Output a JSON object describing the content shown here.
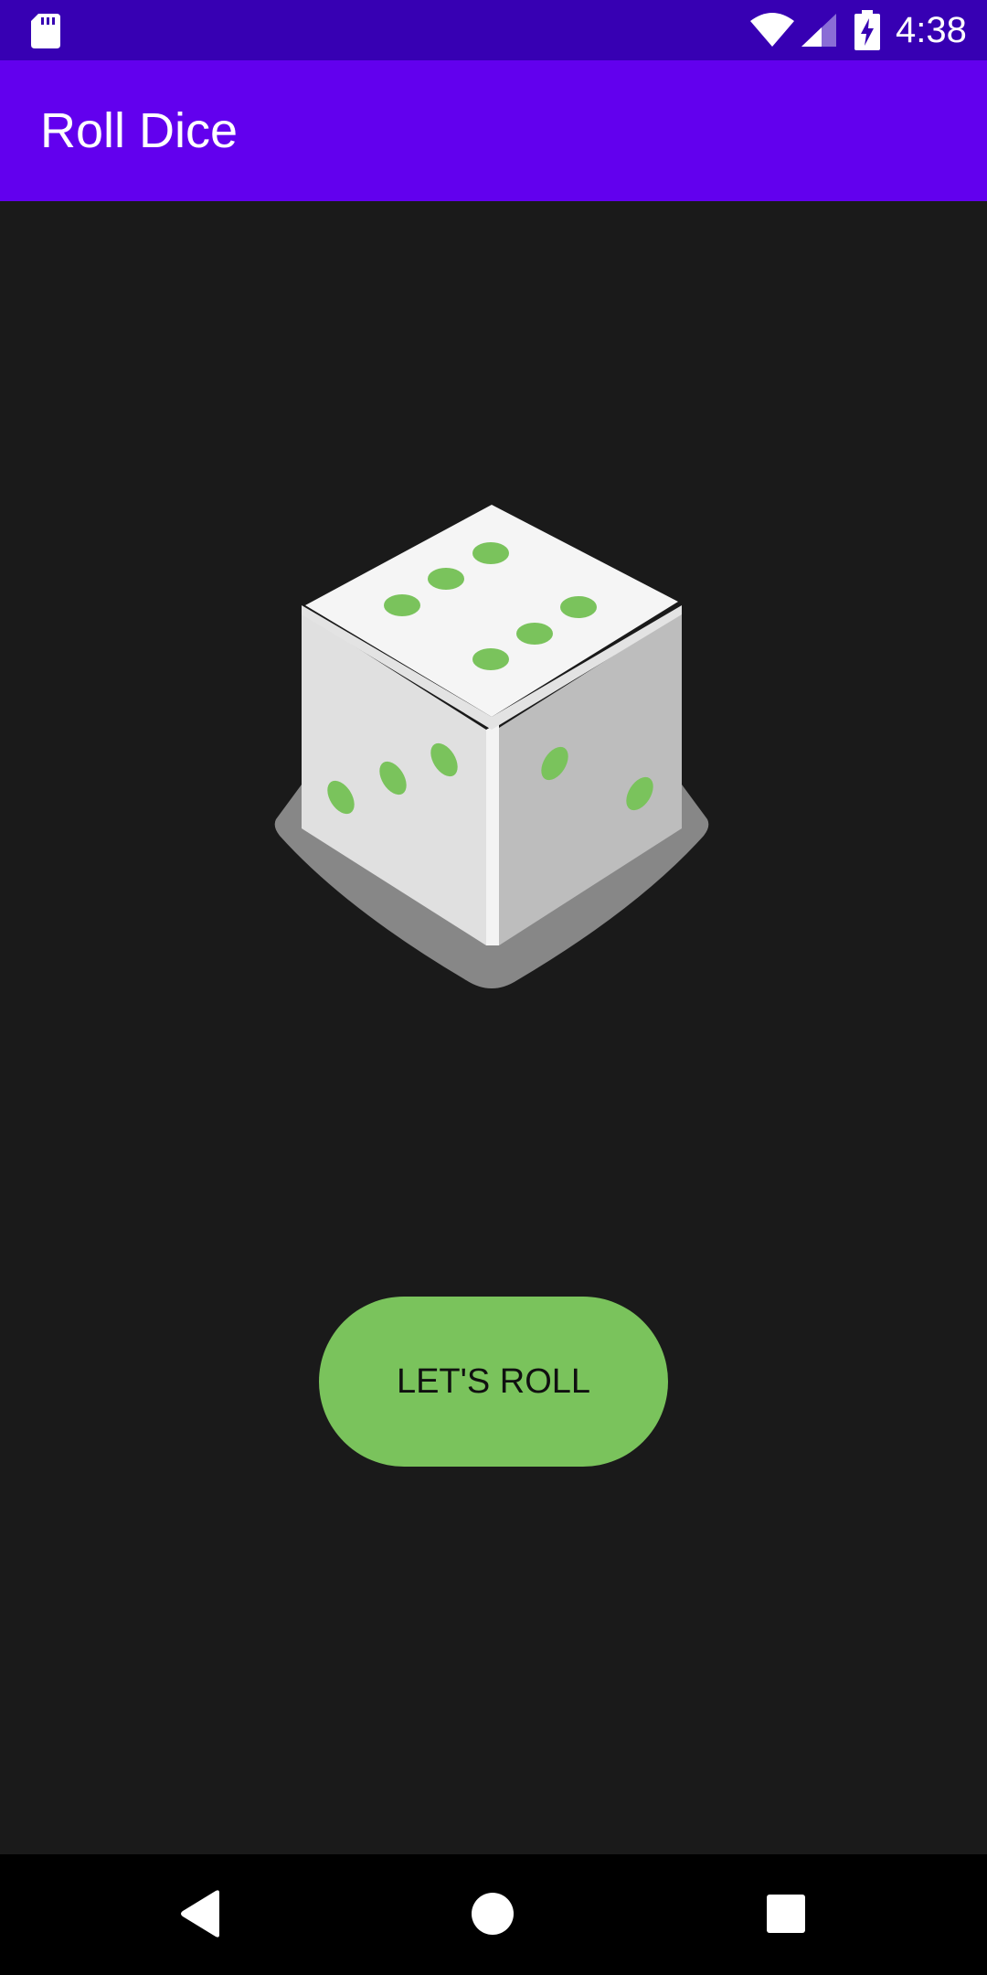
{
  "status_bar": {
    "time": "4:38",
    "icons": [
      "sd-card-icon",
      "wifi-icon",
      "cell-signal-icon",
      "battery-charging-icon"
    ]
  },
  "app_bar": {
    "title": "Roll Dice"
  },
  "dice": {
    "icon": "dice-icon",
    "pip_color": "#7ac35c"
  },
  "roll_button": {
    "label": "LET'S ROLL"
  },
  "nav_bar": {
    "icons": [
      "back-icon",
      "home-icon",
      "recents-icon"
    ]
  },
  "colors": {
    "status_bar": "#3700b3",
    "app_bar": "#6200ee",
    "background": "#1a1a1a",
    "accent": "#7ac35c"
  }
}
